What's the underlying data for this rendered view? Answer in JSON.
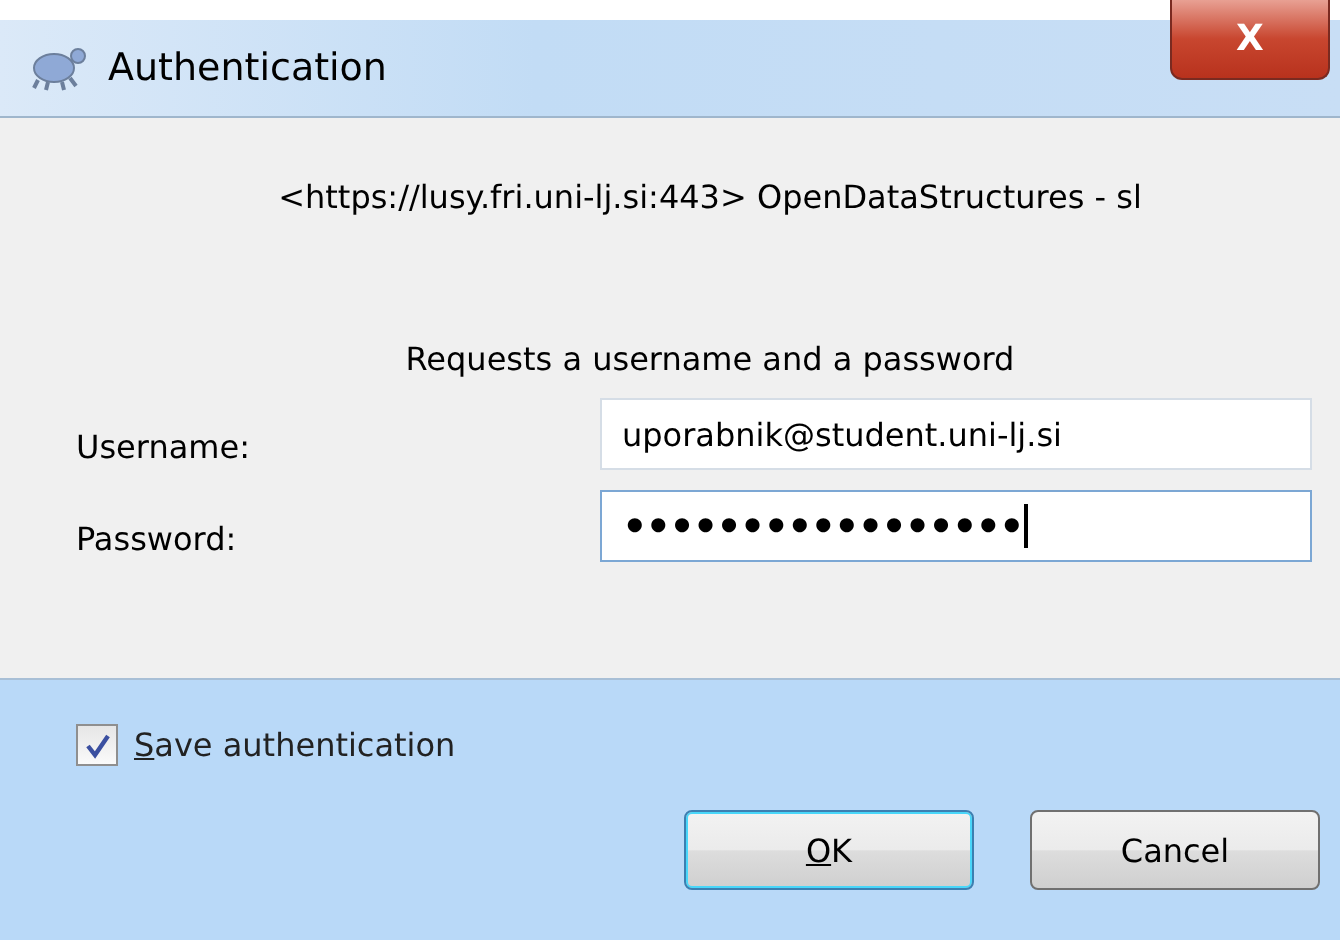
{
  "window": {
    "title": "Authentication",
    "close_label": "X"
  },
  "realm": "<https://lusy.fri.uni-lj.si:443> OpenDataStructures - sl",
  "prompt": "Requests a username and a password",
  "fields": [
    {
      "label": "Username:",
      "value": "uporabnik@student.uni-lj.si",
      "focused": false
    },
    {
      "label": "Password:",
      "value": "•••••••••••••••••",
      "focused": true
    }
  ],
  "save": {
    "label": "Save authentication",
    "checked": true,
    "mnemonic_first": true
  },
  "buttons": [
    {
      "label": "OK",
      "default": true,
      "mnemonic_first": true
    },
    {
      "label": "Cancel",
      "default": false
    }
  ]
}
